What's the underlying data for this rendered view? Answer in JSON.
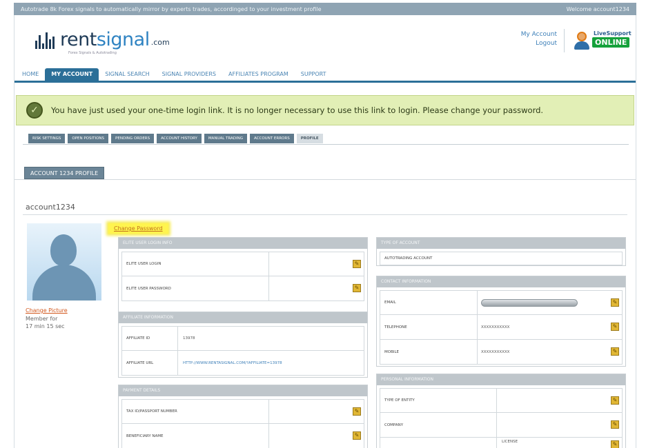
{
  "topbar": {
    "left_text": "Autotrade 8k Forex signals to automatically mirror by experts trades, accordinged to your investment profile",
    "right_text": "Welcome account1234"
  },
  "logo": {
    "brand_light": "rent",
    "brand_main": "signal",
    "tld": ".com",
    "tagline": "Forex Signals & Autotrading"
  },
  "header_links": {
    "my_account": "My Account",
    "logout": "Logout"
  },
  "livesupport": {
    "small": "LiveSupport",
    "status": "ONLINE"
  },
  "nav": [
    {
      "label": "HOME"
    },
    {
      "label": "MY ACCOUNT",
      "active": true
    },
    {
      "label": "SIGNAL SEARCH"
    },
    {
      "label": "SIGNAL PROVIDERS"
    },
    {
      "label": "AFFILIATES PROGRAM"
    },
    {
      "label": "SUPPORT"
    }
  ],
  "alert": {
    "message": "You have just used your one-time login link. It is no longer necessary to use this link to login. Please change your password."
  },
  "subtabs": [
    {
      "label": "RISK SETTINGS"
    },
    {
      "label": "OPEN POSITIONS"
    },
    {
      "label": "PENDING ORDERS"
    },
    {
      "label": "ACCOUNT HISTORY"
    },
    {
      "label": "MANUAL TRADING"
    },
    {
      "label": "ACCOUNT ERRORS"
    },
    {
      "label": "PROFILE",
      "active": true
    }
  ],
  "profile": {
    "tab_label": "ACCOUNT 1234 PROFILE",
    "account_name": "account1234",
    "change_password": "Change Password",
    "change_picture": "Change Picture",
    "member_for_label": "Member for",
    "member_for_value": "17 min 15 sec"
  },
  "sections": {
    "elite": {
      "title": "ELITE USER LOGIN INFO",
      "rows": [
        {
          "label": "ELITE USER LOGIN"
        },
        {
          "label": "ELITE USER PASSWORD"
        }
      ]
    },
    "affiliate": {
      "title": "AFFILIATE INFORMATION",
      "rows": [
        {
          "label": "AFFILIATE ID",
          "value": "13978"
        },
        {
          "label": "AFFILIATE URL",
          "value": "HTTP://WWW.RENTASIGNAL.COM/?AFFILIATE=13978"
        }
      ]
    },
    "payment": {
      "title": "PAYMENT DETAILS",
      "rows": [
        {
          "label": "TAX ID/PASSPORT NUMBER"
        },
        {
          "label": "BENEFICIARY NAME"
        }
      ]
    },
    "account_type": {
      "title": "TYPE OF ACCOUNT",
      "value": "AUTOTRADING ACCOUNT"
    },
    "contact": {
      "title": "CONTACT INFORMATION",
      "rows": [
        {
          "label": "EMAIL"
        },
        {
          "label": "TELEPHONE",
          "value": "XXXXXXXXXXX"
        },
        {
          "label": "MOBILE",
          "value": "XXXXXXXXXXX"
        }
      ]
    },
    "personal": {
      "title": "PERSONAL INFORMATION",
      "rows": [
        {
          "label": "TYPE OF ENTITY"
        },
        {
          "label": "COMPANY"
        },
        {
          "label": "",
          "value": "LICENSE"
        }
      ]
    }
  },
  "icons": {
    "edit": "edit-pencil-icon",
    "check": "check-circle-icon"
  },
  "colors": {
    "nav_active": "#2b6f98",
    "alert_bg": "#e2efb6",
    "online": "#15a13b",
    "highlight": "#fff44f"
  }
}
